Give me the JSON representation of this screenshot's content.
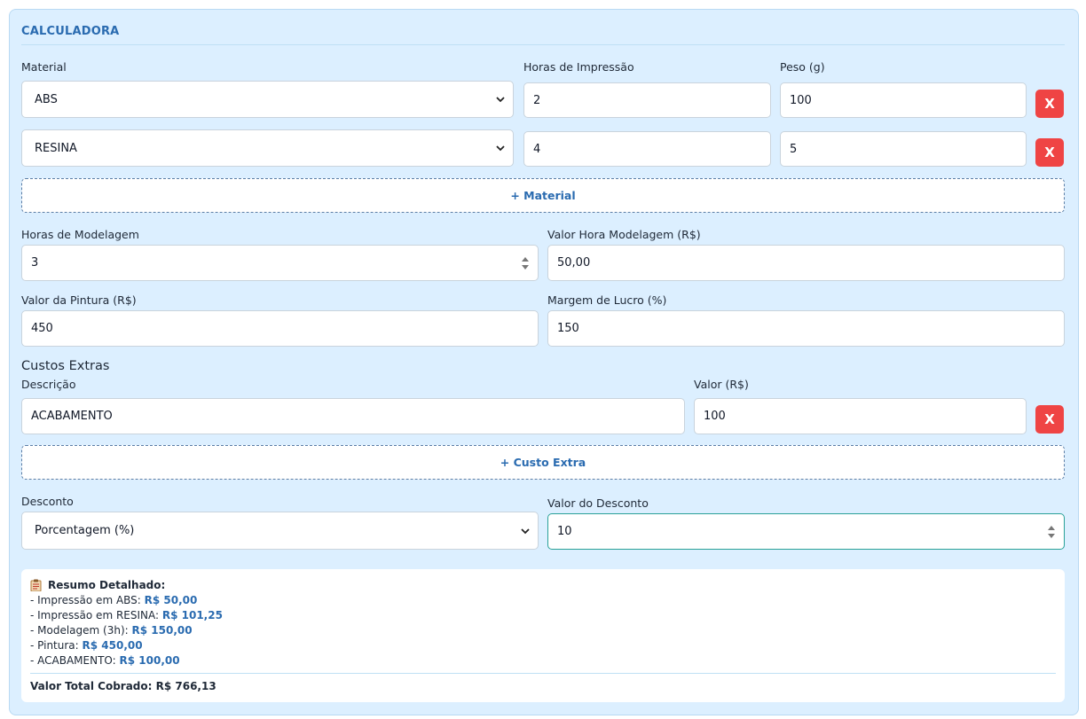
{
  "calculator": {
    "title": "CALCULADORA",
    "labels": {
      "material": "Material",
      "print_hours": "Horas de Impressão",
      "weight": "Peso (g)"
    },
    "materials": [
      {
        "material": "ABS",
        "hours": "2",
        "weight": "100",
        "remove_label": "X"
      },
      {
        "material": "RESINA",
        "hours": "4",
        "weight": "5",
        "remove_label": "X"
      }
    ],
    "add_material_label": "+ Material",
    "modeling": {
      "hours_label": "Horas de Modelagem",
      "hours_value": "3",
      "rate_label": "Valor Hora Modelagem (R$)",
      "rate_value": "50,00"
    },
    "painting": {
      "label": "Valor da Pintura (R$)",
      "value": "450"
    },
    "margin": {
      "label": "Margem de Lucro (%)",
      "value": "150"
    },
    "extras": {
      "heading": "Custos Extras",
      "description_label": "Descrição",
      "value_label": "Valor (R$)",
      "items": [
        {
          "description": "ACABAMENTO",
          "value": "100",
          "remove_label": "X"
        }
      ],
      "add_label": "+ Custo Extra"
    },
    "discount": {
      "type_label": "Desconto",
      "type_value": "Porcentagem (%)",
      "value_label": "Valor do Desconto",
      "value": "10"
    },
    "summary": {
      "heading": "Resumo Detalhado:",
      "lines": [
        {
          "text": "- Impressão em ABS: ",
          "amount": "R$ 50,00"
        },
        {
          "text": "- Impressão em RESINA: ",
          "amount": "R$ 101,25"
        },
        {
          "text": "- Modelagem (3h): ",
          "amount": "R$ 150,00"
        },
        {
          "text": "- Pintura: ",
          "amount": "R$ 450,00"
        },
        {
          "text": "- ACABAMENTO: ",
          "amount": "R$ 100,00"
        }
      ],
      "total": "Valor Total Cobrado: R$ 766,13"
    }
  },
  "colors": {
    "panel_bg": "#dcefff",
    "accent": "#2a6bb0",
    "danger": "#ef4444"
  }
}
